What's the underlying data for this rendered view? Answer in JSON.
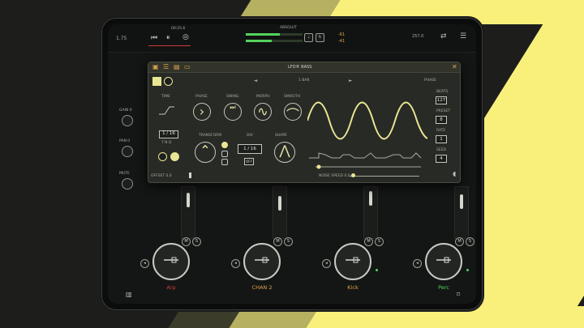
{
  "colors": {
    "yellow": "#f8f07a",
    "olive": "#b6b061",
    "dark_olive": "#3c3c2b",
    "red": "#d03c3c",
    "orange": "#e0a44e",
    "green": "#55d35c",
    "wave": "#e9e693"
  },
  "topbar": {
    "left_value": "1.75",
    "time": "00:25.6",
    "mode": "ABSOLUT",
    "level_left": "-61",
    "level_right": "-41",
    "right_value": "257.0"
  },
  "panel": {
    "title": "LFO® BASS",
    "tabs_icons": [
      "dice-icon",
      "sliders-icon",
      "grid-icon",
      "folder-icon"
    ],
    "nav": {
      "prev": "◄",
      "label": "1 BAR",
      "next": "►",
      "rate_label": "PHASE"
    },
    "controls": {
      "time": "TIME",
      "phase": "PHASE",
      "swing": "SWING",
      "morph": "MORPH",
      "smooth": "SMOOTH",
      "transform": "TRANSFORM",
      "div": "DIV",
      "shape": "SHAPE"
    },
    "time_value": "1 / 16",
    "time_sub": "T N D",
    "div_value": "1 / 16",
    "div_sub": "OFF",
    "side_labels": [
      "BEATS",
      "PRESET",
      "RATE",
      "SEED"
    ],
    "side_values": [
      "127",
      "8",
      "1",
      "4"
    ],
    "footer": {
      "left": "OFFSET 0.0",
      "mid": "NOISE SPEED 0.0"
    }
  },
  "channels": [
    {
      "name": "Arp",
      "color": "#d03c3c",
      "mute": "M",
      "solo": "S"
    },
    {
      "name": "CHAN 2",
      "color": "#e0a44e",
      "mute": "M",
      "solo": "S"
    },
    {
      "name": "Kick",
      "color": "#e0a44e",
      "mute": "M",
      "solo": "S"
    },
    {
      "name": "Perc",
      "color": "#55d35c",
      "mute": "M",
      "solo": "S"
    }
  ],
  "side": {
    "knob_labels": [
      "GAIN 0",
      "PAN 0",
      "MUTE"
    ]
  }
}
